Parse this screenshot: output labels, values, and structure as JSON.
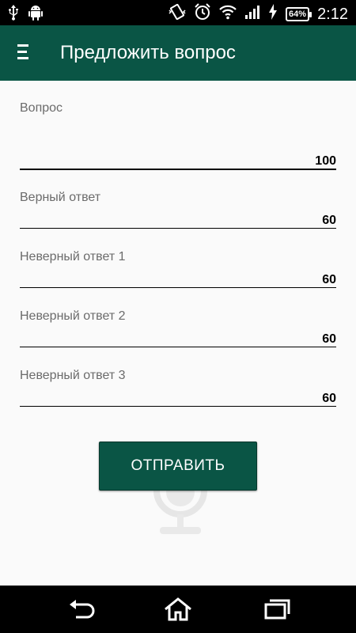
{
  "status_bar": {
    "time": "2:12",
    "battery": "64%",
    "icons": [
      "usb-icon",
      "android-icon",
      "vibrate-icon",
      "alarm-icon",
      "wifi-icon",
      "signal-icon",
      "charging-icon",
      "battery-icon"
    ]
  },
  "app_bar": {
    "title": "Предложить вопрос",
    "menu_icon": "menu-icon"
  },
  "form": {
    "question": {
      "label": "Вопрос",
      "value": "",
      "counter": "100"
    },
    "correct_answer": {
      "label": "Верный ответ",
      "value": "",
      "counter": "60"
    },
    "wrong_answer_1": {
      "label": "Неверный ответ 1",
      "value": "",
      "counter": "60"
    },
    "wrong_answer_2": {
      "label": "Неверный ответ 2",
      "value": "",
      "counter": "60"
    },
    "wrong_answer_3": {
      "label": "Неверный ответ 3",
      "value": "",
      "counter": "60"
    }
  },
  "submit_label": "ОТПРАВИТЬ",
  "colors": {
    "primary": "#0a5545",
    "background": "#fafafa",
    "label": "#6b6b6b"
  },
  "nav_bar": {
    "icons": [
      "back-icon",
      "home-icon",
      "recents-icon"
    ]
  }
}
